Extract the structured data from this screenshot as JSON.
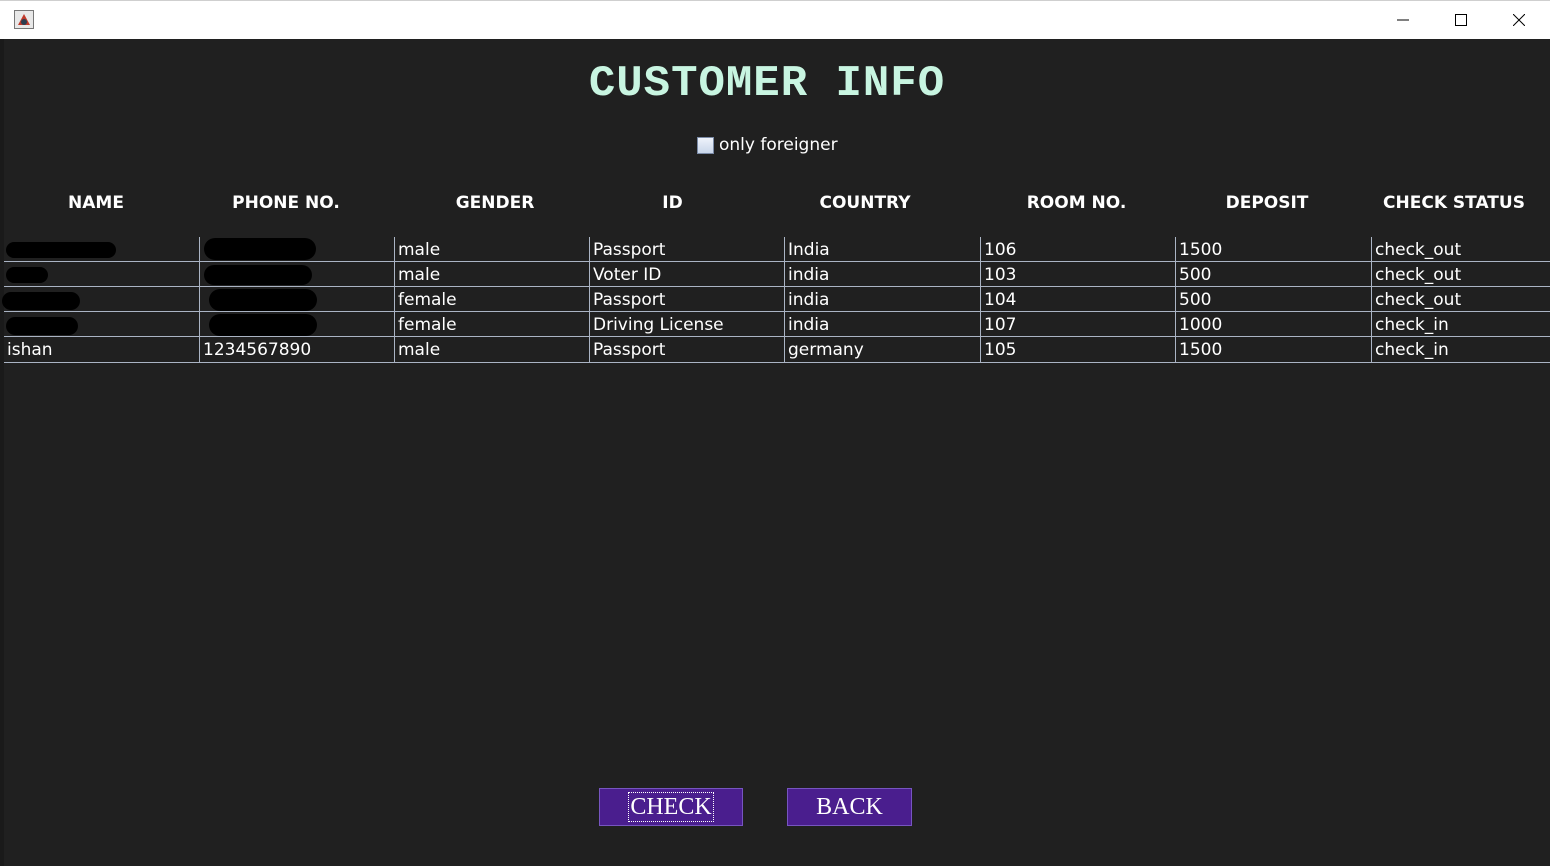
{
  "window": {
    "icons": [
      "java-app-icon",
      "minimize-icon",
      "maximize-icon",
      "close-icon"
    ]
  },
  "page": {
    "title": "CUSTOMER INFO",
    "filter_label": "only foreigner",
    "filter_checked": false
  },
  "table": {
    "headers": [
      "NAME",
      "PHONE NO.",
      "GENDER",
      "ID",
      "COUNTRY",
      "ROOM NO.",
      "DEPOSIT",
      "CHECK STATUS"
    ],
    "rows": [
      {
        "name": "",
        "phone": "",
        "gender": "male",
        "id": "Passport",
        "country": "India",
        "room": "106",
        "deposit": "1500",
        "status": "check_out"
      },
      {
        "name": "",
        "phone": "",
        "gender": "male",
        "id": "Voter ID",
        "country": "india",
        "room": "103",
        "deposit": "500",
        "status": "check_out"
      },
      {
        "name": "",
        "phone": "",
        "gender": "female",
        "id": "Passport",
        "country": "india",
        "room": "104",
        "deposit": "500",
        "status": "check_out"
      },
      {
        "name": "",
        "phone": "",
        "gender": "female",
        "id": "Driving License",
        "country": "india",
        "room": "107",
        "deposit": "1000",
        "status": "check_in"
      },
      {
        "name": "ishan",
        "phone": "1234567890",
        "gender": "male",
        "id": "Passport",
        "country": "germany",
        "room": "105",
        "deposit": "1500",
        "status": "check_in"
      }
    ]
  },
  "buttons": {
    "check_label": "CHECK",
    "back_label": "BACK"
  },
  "colors": {
    "background": "#202020",
    "title": "#c8f5e1",
    "button": "#4a1e8e",
    "grid": "#aab4c4"
  }
}
